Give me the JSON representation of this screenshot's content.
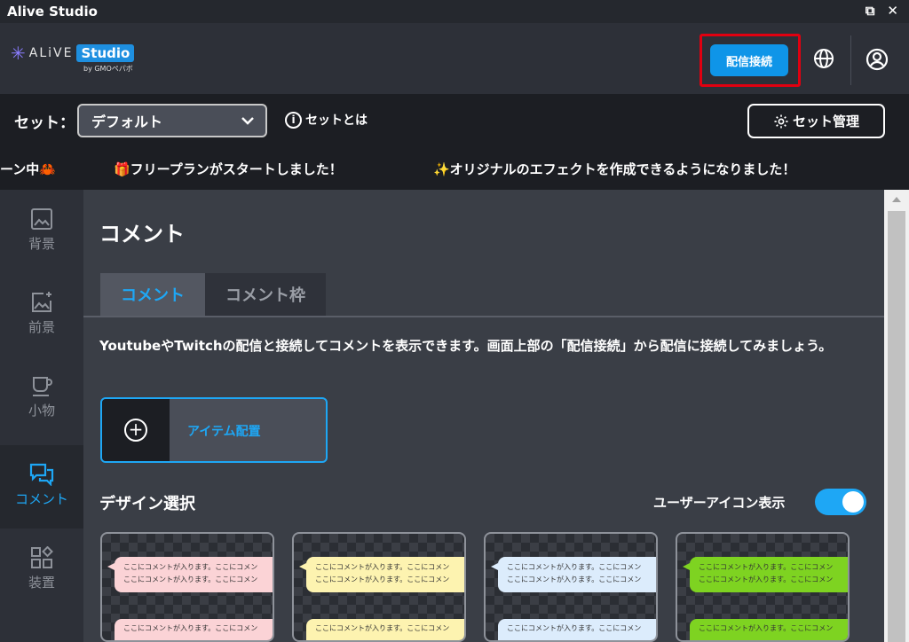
{
  "window": {
    "title": "Alive Studio"
  },
  "header": {
    "logo_alive": "ALiVE",
    "logo_studio": "Studio",
    "logo_by": "by GMOペパボ",
    "connect_label": "配信接続"
  },
  "setbar": {
    "label": "セット：",
    "selected": "デフォルト",
    "info_label": "セットとは",
    "manage_label": "セット管理"
  },
  "ticker": {
    "items": [
      "ーン中🦀",
      "🎁フリープランがスタートしました！",
      "✨オリジナルのエフェクトを作成できるようになりました！"
    ]
  },
  "sidebar": {
    "items": [
      {
        "label": "背景",
        "icon": "image-icon"
      },
      {
        "label": "前景",
        "icon": "image-plus-icon"
      },
      {
        "label": "小物",
        "icon": "cup-icon"
      },
      {
        "label": "コメント",
        "icon": "comment-icon"
      },
      {
        "label": "装置",
        "icon": "widgets-icon"
      }
    ]
  },
  "main": {
    "title": "コメント",
    "tabs": [
      {
        "label": "コメント"
      },
      {
        "label": "コメント枠"
      }
    ],
    "description": "YoutubeやTwitchの配信と接続してコメントを表示できます。画面上部の「配信接続」から配信に接続してみましょう。",
    "item_place_label": "アイテム配置",
    "design_title": "デザイン選択",
    "toggle_label": "ユーザーアイコン表示",
    "toggle_on": true,
    "card_text_line": "ここにコメントが入ります。ここにコメン",
    "cards": [
      {
        "color": "#fbd3d6"
      },
      {
        "color": "#fdf3b0"
      },
      {
        "color": "#dcecfc"
      },
      {
        "color": "#7ed321"
      }
    ]
  },
  "colors": {
    "accent": "#1ea7f5",
    "connect": "#0f95e8",
    "highlight": "#e10010"
  }
}
